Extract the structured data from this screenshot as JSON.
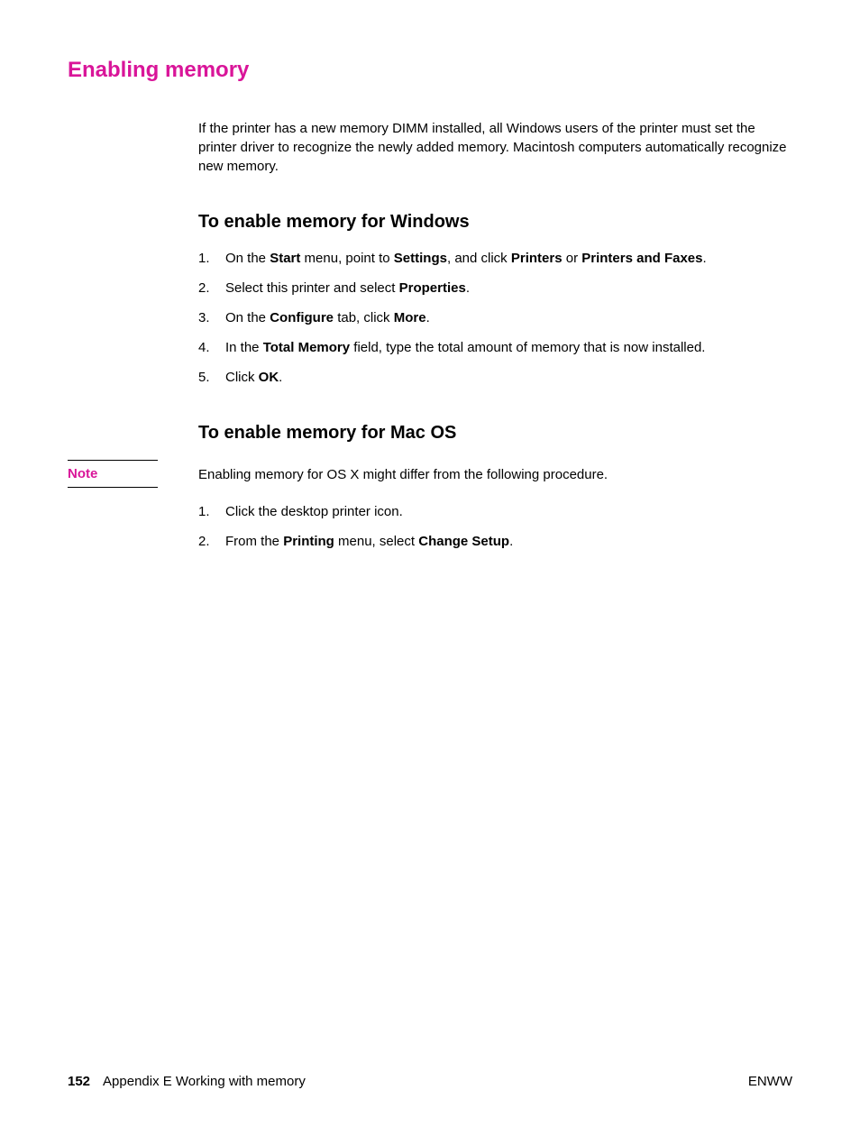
{
  "heading": "Enabling memory",
  "intro": "If the printer has a new memory DIMM installed, all Windows users of the printer must set the printer driver to recognize the newly added memory. Macintosh computers automatically recognize new memory.",
  "section_windows": {
    "heading": "To enable memory for Windows",
    "steps": [
      {
        "pre": "On the ",
        "b1": "Start",
        "mid1": " menu, point to ",
        "b2": "Settings",
        "mid2": ", and click ",
        "b3": "Printers",
        "mid3": " or ",
        "b4": "Printers and Faxes",
        "post": "."
      },
      {
        "pre": "Select this printer and select ",
        "b1": "Properties",
        "post": "."
      },
      {
        "pre": "On the ",
        "b1": "Configure",
        "mid1": " tab, click ",
        "b2": "More",
        "post": "."
      },
      {
        "pre": "In the ",
        "b1": "Total Memory",
        "post": " field, type the total amount of memory that is now installed."
      },
      {
        "pre": "Click ",
        "b1": "OK",
        "post": "."
      }
    ]
  },
  "section_mac": {
    "heading": "To enable memory for Mac OS",
    "note_label": "Note",
    "note_text": "Enabling memory for OS X might differ from the following procedure.",
    "steps": [
      {
        "pre": "Click the desktop printer icon."
      },
      {
        "pre": "From the ",
        "b1": "Printing",
        "mid1": " menu, select ",
        "b2": "Change Setup",
        "post": "."
      }
    ]
  },
  "footer": {
    "page_number": "152",
    "appendix": "Appendix E  Working with memory",
    "right": "ENWW"
  }
}
